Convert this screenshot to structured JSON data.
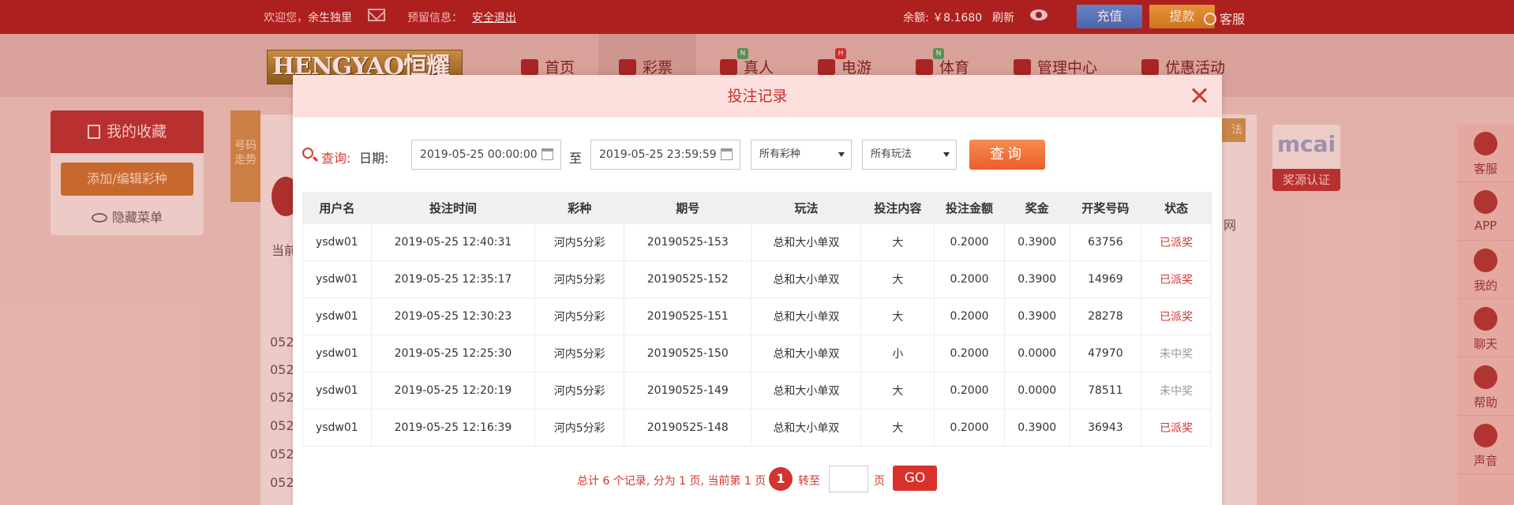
{
  "topbar": {
    "welcome_prefix": "欢迎您，",
    "username": "余生独里",
    "notice_label": "预留信息：",
    "logout": "安全退出",
    "balance": "余额: ￥8.1680",
    "refresh": "刷新",
    "recharge": "充值",
    "withdraw": "提款",
    "service": "客服"
  },
  "logo": {
    "text": "HENGYAO恒耀"
  },
  "nav": {
    "items": [
      {
        "label": "首页",
        "badge": ""
      },
      {
        "label": "彩票",
        "badge": ""
      },
      {
        "label": "真人",
        "badge": "N"
      },
      {
        "label": "电游",
        "badge": "H"
      },
      {
        "label": "体育",
        "badge": "N"
      },
      {
        "label": "管理中心",
        "badge": ""
      },
      {
        "label": "优惠活动",
        "badge": ""
      }
    ]
  },
  "favorites": {
    "title": "我的收藏",
    "add_button": "添加/编辑彩种",
    "hide_menu": "隐藏菜单"
  },
  "trend_tab": "号码走势",
  "right_badge": {
    "logo": "mcai",
    "cert": "奖源认证"
  },
  "orange_tab": "法",
  "bg_text": {
    "current": "当前",
    "wang": "网",
    "rows": [
      "052",
      "052",
      "052",
      "052",
      "052",
      "052"
    ]
  },
  "rail": [
    "客服",
    "APP",
    "我的",
    "聊天",
    "帮助",
    "声音"
  ],
  "modal": {
    "title": "投注记录",
    "query_label": "查询:",
    "date_label": "日期:",
    "start_date": "2019-05-25 00:00:00",
    "to_label": "至",
    "end_date": "2019-05-25 23:59:59",
    "lottery_select": "所有彩种",
    "play_select": "所有玩法",
    "query_button": "查询"
  },
  "table": {
    "headers": [
      "用户名",
      "投注时间",
      "彩种",
      "期号",
      "玩法",
      "投注内容",
      "投注金额",
      "奖金",
      "开奖号码",
      "状态"
    ],
    "rows": [
      [
        "ysdw01",
        "2019-05-25 12:40:31",
        "河内5分彩",
        "20190525-153",
        "总和大小单双",
        "大",
        "0.2000",
        "0.3900",
        "63756",
        "已派奖"
      ],
      [
        "ysdw01",
        "2019-05-25 12:35:17",
        "河内5分彩",
        "20190525-152",
        "总和大小单双",
        "大",
        "0.2000",
        "0.3900",
        "14969",
        "已派奖"
      ],
      [
        "ysdw01",
        "2019-05-25 12:30:23",
        "河内5分彩",
        "20190525-151",
        "总和大小单双",
        "大",
        "0.2000",
        "0.3900",
        "28278",
        "已派奖"
      ],
      [
        "ysdw01",
        "2019-05-25 12:25:30",
        "河内5分彩",
        "20190525-150",
        "总和大小单双",
        "小",
        "0.2000",
        "0.0000",
        "47970",
        "未中奖"
      ],
      [
        "ysdw01",
        "2019-05-25 12:20:19",
        "河内5分彩",
        "20190525-149",
        "总和大小单双",
        "大",
        "0.2000",
        "0.0000",
        "78511",
        "未中奖"
      ],
      [
        "ysdw01",
        "2019-05-25 12:16:39",
        "河内5分彩",
        "20190525-148",
        "总和大小单双",
        "大",
        "0.2000",
        "0.3900",
        "36943",
        "已派奖"
      ]
    ]
  },
  "pager": {
    "summary": "总计 6 个记录, 分为 1 页, 当前第 1 页",
    "current_page": "1",
    "goto_label": "转至",
    "page_unit": "页",
    "go_button": "GO"
  },
  "colors": {
    "brand_red": "#a31619",
    "accent_red": "#d2342f",
    "orange": "#ec5c2c"
  }
}
